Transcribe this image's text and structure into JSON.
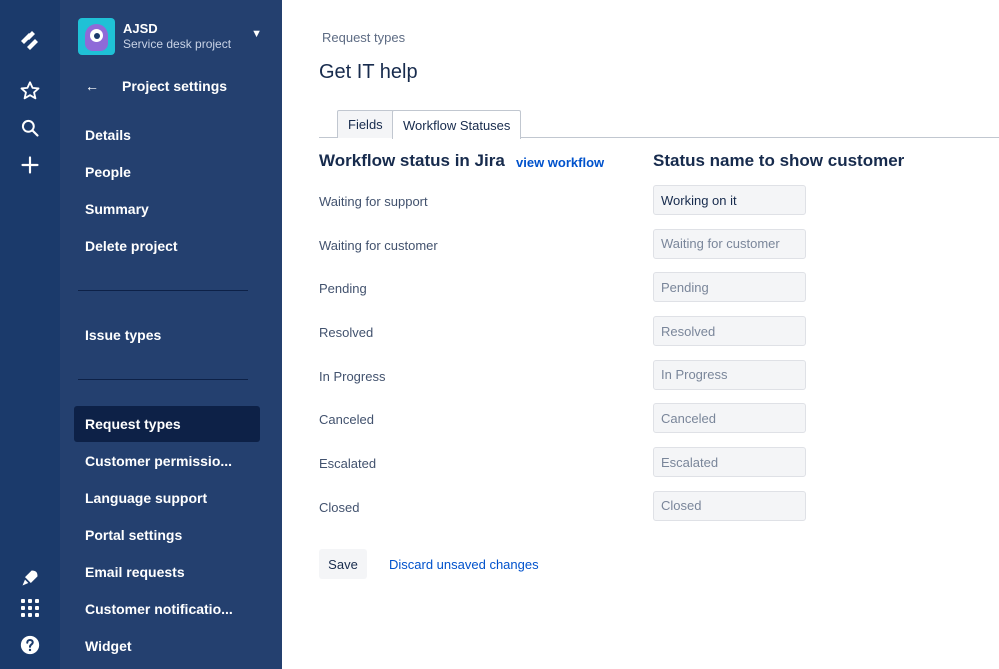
{
  "rail": {
    "icons": [
      "jira-logo-icon",
      "star-icon",
      "search-icon",
      "plus-icon",
      "rocket-icon",
      "app-switcher-icon",
      "help-icon"
    ]
  },
  "project": {
    "name": "AJSD",
    "subtitle": "Service desk project"
  },
  "sidebar": {
    "back_label": "Project settings",
    "items_group1": [
      "Details",
      "People",
      "Summary",
      "Delete project"
    ],
    "items_group2": [
      "Issue types"
    ],
    "items_group3": [
      "Request types",
      "Customer permissio...",
      "Language support",
      "Portal settings",
      "Email requests",
      "Customer notificatio...",
      "Widget"
    ],
    "active_item": "Request types"
  },
  "main": {
    "breadcrumb": "Request types",
    "title": "Get IT help",
    "tabs": [
      {
        "label": "Fields"
      },
      {
        "label": "Workflow Statuses"
      }
    ],
    "active_tab": "Workflow Statuses",
    "col1_header": "Workflow status in Jira",
    "view_workflow_link": "view workflow",
    "col2_header": "Status name to show customer",
    "statuses": [
      {
        "jira_status": "Waiting for support",
        "customer_value": "Working on it",
        "placeholder": ""
      },
      {
        "jira_status": "Waiting for customer",
        "customer_value": "",
        "placeholder": "Waiting for customer"
      },
      {
        "jira_status": "Pending",
        "customer_value": "",
        "placeholder": "Pending"
      },
      {
        "jira_status": "Resolved",
        "customer_value": "",
        "placeholder": "Resolved"
      },
      {
        "jira_status": "In Progress",
        "customer_value": "",
        "placeholder": "In Progress"
      },
      {
        "jira_status": "Canceled",
        "customer_value": "",
        "placeholder": "Canceled"
      },
      {
        "jira_status": "Escalated",
        "customer_value": "",
        "placeholder": "Escalated"
      },
      {
        "jira_status": "Closed",
        "customer_value": "",
        "placeholder": "Closed"
      }
    ],
    "save_label": "Save",
    "discard_label": "Discard unsaved changes"
  },
  "colors": {
    "rail_bg": "#1b3a6b",
    "sidebar_bg": "#24406f",
    "active_item_bg": "#0d2147",
    "link": "#0052cc",
    "avatar_bg": "#1fc1d6",
    "avatar_monster": "#8f6ad8"
  }
}
